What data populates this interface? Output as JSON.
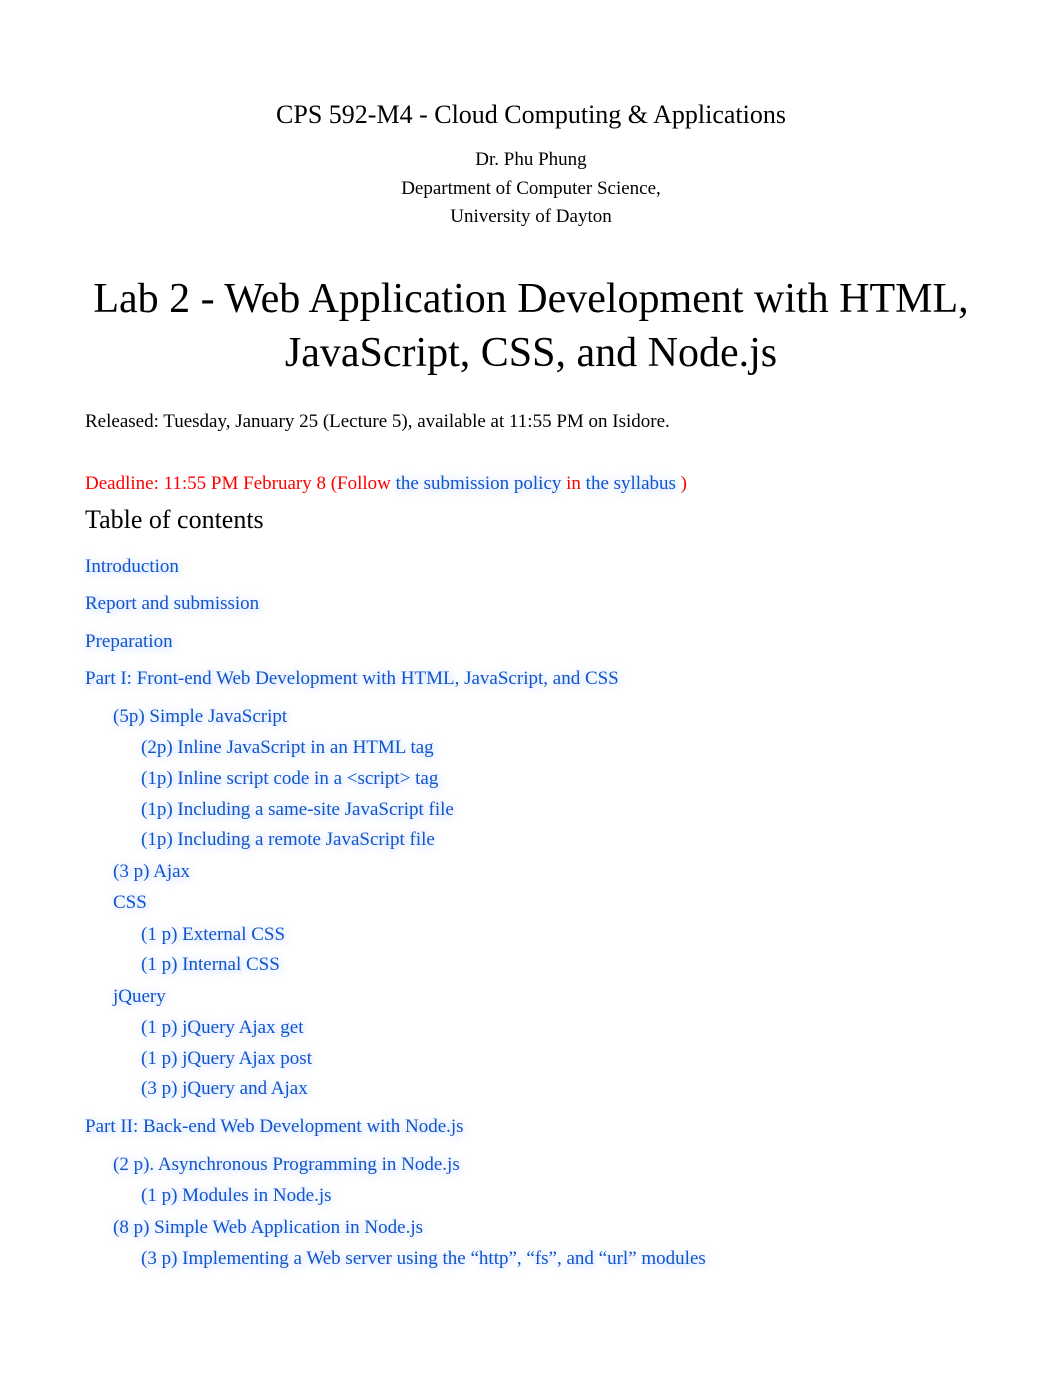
{
  "header": {
    "course": "CPS 592-M4 - Cloud Computing & Applications",
    "instructor": "Dr. Phu Phung",
    "department": "Department of Computer Science,",
    "university": "University of Dayton",
    "lab_title": "Lab 2 - Web Application Development with HTML, JavaScript, CSS, and Node.js"
  },
  "meta": {
    "released": "Released: Tuesday, January 25 (Lecture 5), available at 11:55 PM on Isidore.",
    "deadline_pre": "Deadline: 11:55 PM February 8 (Follow ",
    "deadline_link1": "the submission policy",
    "deadline_mid": " in ",
    "deadline_link2": "the syllabus",
    "deadline_post": ")"
  },
  "toc_heading": "Table of contents",
  "toc": {
    "intro": "Introduction",
    "report": "Report and submission",
    "prep": "Preparation",
    "part1": {
      "title": "Part I: Front-end Web Development with HTML, JavaScript, and CSS",
      "simple_js": {
        "title": "(5p) Simple JavaScript",
        "a": "(2p) Inline JavaScript in an HTML tag",
        "b": "(1p) Inline script code in a <script> tag",
        "c": "(1p) Including a same-site JavaScript file",
        "d": "(1p) Including a remote JavaScript file"
      },
      "ajax": "(3 p) Ajax",
      "css": {
        "title": "CSS",
        "a": "(1 p) External CSS",
        "b": "(1 p) Internal CSS"
      },
      "jquery": {
        "title": "jQuery",
        "a": "(1 p) jQuery Ajax get",
        "b": "(1 p) jQuery Ajax post",
        "c": "(3 p) jQuery and Ajax"
      }
    },
    "part2": {
      "title": "Part II: Back-end Web Development with Node.js",
      "async": {
        "title": "(2 p). Asynchronous Programming in Node.js",
        "a": "(1 p) Modules in Node.js"
      },
      "simpleweb": {
        "title": "(8 p) Simple Web Application in Node.js",
        "a": "(3 p) Implementing a Web server using the “http”, “fs”, and “url” modules"
      }
    }
  }
}
